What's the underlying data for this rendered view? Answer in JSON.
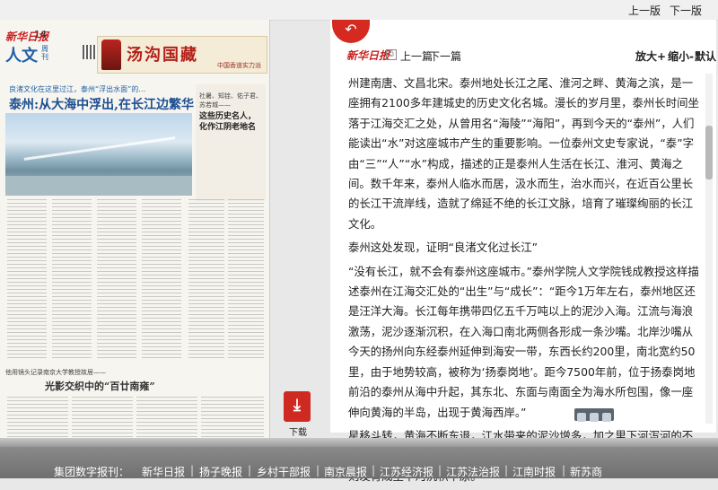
{
  "topbar": {
    "prev_edition": "上一版",
    "next_edition": "下一版"
  },
  "paper": {
    "logo": "新华日报",
    "page_number": "14",
    "section": "人文",
    "section_sub": "周刊",
    "ad_text": "汤沟国藏",
    "ad_sub": "中国香道实力派",
    "kicker": "良渚文化在这里过江，泰州“浮出水面”的…",
    "headline": "泰州:从大海中浮出,在长江边繁华",
    "side_kicker": "社暑、知铨、佑子君、苏若城——",
    "side_headline": "这些历史名人，化作江阴老地名",
    "sub_kicker": "他用镜头记录南京大学教授故居——",
    "sub_headline": "光影交织中的“百廿南雍”"
  },
  "reader": {
    "back_icon": "back-arrow-icon",
    "logo": "新华日报",
    "prev_article": "上一篇",
    "next_article": "下一篇",
    "zoom_in": "放大+",
    "zoom_out": "缩小-",
    "default_size": "默认",
    "paragraphs": [
      "州建南唐、文昌北宋。泰州地处长江之尾、淮河之畔、黄海之滨，是一座拥有2100多年建城史的历史文化名城。漫长的岁月里，泰州长时间坐落于江海交汇之处，从曾用名“海陵”“海阳”，再到今天的“泰州”，人们能读出“水”对这座城市产生的重要影响。一位泰州文史专家说，“泰”字由“三”“人”“水”构成，描述的正是泰州人生活在长江、淮河、黄海之间。数千年来，泰州人临水而居，汲水而生，治水而兴，在近百公里长的长江干流岸线，造就了绵延不绝的长江文脉，培育了璀璨绚丽的长江文化。",
      "泰州这处发现，证明“良渚文化过长江”",
      "“没有长江，就不会有泰州这座城市。”泰州学院人文学院钱成教授这样描述泰州在江海交汇处的“出生”与“成长”：“距今1万年左右，泰州地区还是汪洋大海。长江每年携带四亿五千万吨以上的泥沙入海。江流与海浪激荡，泥沙逐渐沉积，在入海口南北两侧各形成一条沙嘴。北岸沙嘴从今天的扬州向东经泰州延伸到海安一带，东西长约200里，南北宽约50里，由于地势较高，被称为‘扬泰岗地’。距今7500年前，位于扬泰岗地前沿的泰州从海中升起，其东北、东面与南面全为海水所包围，像一座伸向黄海的半岛，出现于黄海西岸。”",
      "星移斗转，黄海不断东退，江水带来的泥沙增多，加之里下河泻河的不断沉积，沧海桑田的变迁中，泰州南边成为长江三角洲冲积平原，北边则发育成里下河沉积平原。"
    ]
  },
  "download": {
    "icon": "pdf-icon",
    "label": "下载"
  },
  "footer": {
    "lead": "集团数字报刊：",
    "links": [
      "新华日报",
      "扬子晚报",
      "乡村干部报",
      "南京晨报",
      "江苏经济报",
      "江苏法治报",
      "江南时报",
      "新苏商"
    ]
  }
}
